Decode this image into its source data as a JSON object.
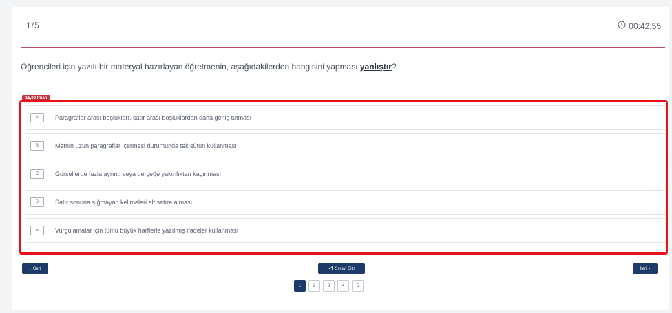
{
  "header": {
    "counter": "1/5",
    "timer": "00:42:55"
  },
  "question": {
    "text_before": "Öğrencileri için yazılı bir materyal hazırlayan öğretmenin, aşağıdakilerden hangisini yapması ",
    "keyword": "yanlıştır",
    "text_after": "?"
  },
  "points_badge": "15,00 Puan",
  "options": [
    {
      "letter": "A",
      "text": "Paragraflar arası boşlukları, satır arası boşluklardan daha geniş tutması"
    },
    {
      "letter": "B",
      "text": "Metnin uzun paragraflar içermesi durumunda tek sütun kullanması"
    },
    {
      "letter": "C",
      "text": "Görsellerde fazla ayrıntı veya gerçeğe yakınlıktan kaçınması"
    },
    {
      "letter": "D",
      "text": "Satır sonuna sığmayan kelimeleri alt satıra alması"
    },
    {
      "letter": "E",
      "text": "Vurgulamalar için tümü büyük harflerle yazılmış ifadeler kullanması"
    }
  ],
  "nav": {
    "prev_label": "Geri",
    "finish_label": "Sınavı Bitir",
    "next_label": "İleri"
  },
  "pages": [
    "1",
    "2",
    "3",
    "4",
    "5"
  ],
  "colors": {
    "accent": "#1d3a68",
    "badge": "#c9313d",
    "highlight": "#e8101b",
    "divider": "#c0506a"
  }
}
